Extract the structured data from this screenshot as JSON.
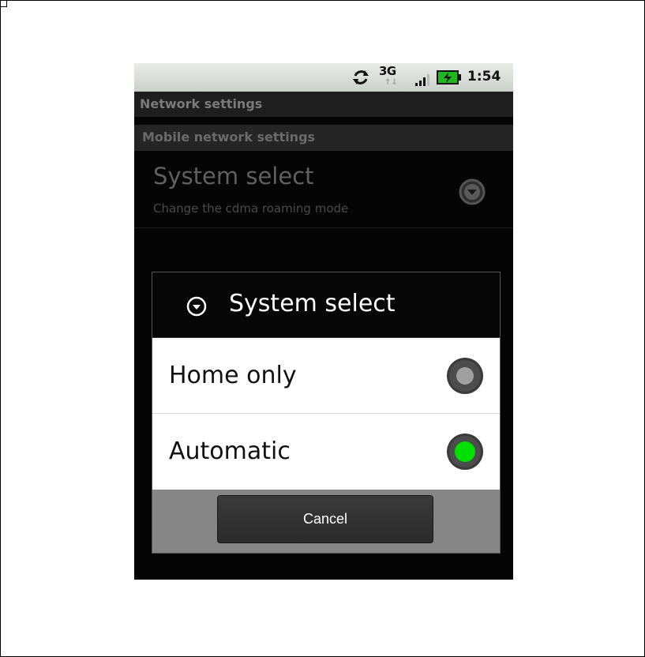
{
  "status_bar": {
    "network": "3G",
    "time": "1:54",
    "icons": [
      "sync-icon",
      "signal-icon",
      "battery-charging-icon"
    ]
  },
  "settings": {
    "header": "Network settings",
    "section_header": "Mobile network settings",
    "preference": {
      "title": "System select",
      "summary": "Change the cdma roaming mode",
      "icon": "chevron-down-circle-icon"
    }
  },
  "dialog": {
    "title": "System select",
    "title_icon": "chevron-down-circle-icon",
    "options": [
      {
        "label": "Home only",
        "selected": false
      },
      {
        "label": "Automatic",
        "selected": true
      }
    ],
    "cancel_label": "Cancel"
  },
  "colors": {
    "radio_selected": "#00e000",
    "radio_unselected": "#a0a0a0"
  }
}
